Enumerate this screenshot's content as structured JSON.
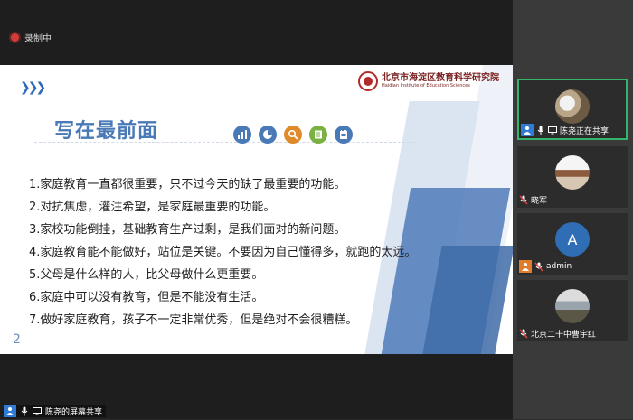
{
  "recording": {
    "label": "录制中",
    "dot_color": "#d23b3b"
  },
  "slide": {
    "logo_cn": "北京市海淀区教育科学研究院",
    "logo_en": "Haidian Institute of Education Sciences",
    "title": "写在最前面",
    "items": [
      "1.家庭教育一直都很重要，只不过今天的缺了最重要的功能。",
      "2.对抗焦虑，灌注希望，是家庭最重要的功能。",
      "3.家校功能倒挂，基础教育生产过剩，是我们面对的新问题。",
      "4.家庭教育能不能做好，站位是关键。不要因为自己懂得多，就跑的太远。",
      "5.父母是什么样的人，比父母做什么更重要。",
      "6.家庭中可以没有教育，但是不能没有生活。",
      "7.做好家庭教育，孩子不一定非常优秀，但是绝对不会很糟糕。"
    ],
    "page_number": "2",
    "icon_names": [
      "bar-chart-icon",
      "pie-chart-icon",
      "magnifier-icon",
      "book-icon",
      "notepad-icon"
    ],
    "icon_colors": [
      "#4a79b8",
      "#4a79b8",
      "#e08a2b",
      "#7bb043",
      "#4a79b8"
    ]
  },
  "participants": [
    {
      "name": "陈尧正在共享",
      "active": true,
      "role": "sharing"
    },
    {
      "name": "晓军",
      "active": false
    },
    {
      "name": "admin",
      "active": false,
      "avatar_letter": "A"
    },
    {
      "name": "北京二十中曹宇红",
      "active": false
    }
  ],
  "share_status": {
    "label": "陈尧的屏幕共享"
  },
  "colors": {
    "accent_green": "#35b56a",
    "avatar_blue": "#2f6db5",
    "host_badge_blue": "#2f7bd6",
    "user_badge_orange": "#e07c2a"
  }
}
